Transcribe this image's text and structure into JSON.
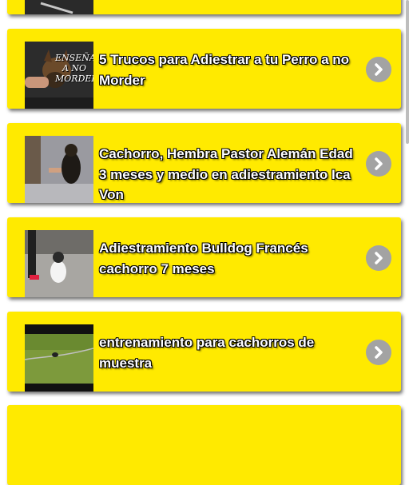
{
  "videos": [
    {
      "title": ""
    },
    {
      "title": "5 Trucos para Adiestrar a tu Perro a no Morder",
      "thumb_caption": "ENSEÑALE A NO MORDER"
    },
    {
      "title": "Cachorro, Hembra Pastor Alemán Edad 3 meses y medio en adiestramiento Ica Von"
    },
    {
      "title": "Adiestramiento Bulldog Francés cachorro 7 meses"
    },
    {
      "title": "entrenamiento para cachorros de muestra"
    },
    {
      "title": ""
    }
  ],
  "icons": {
    "next": "chevron-right-icon"
  },
  "colors": {
    "card": "#ffea00",
    "chevron_bg": "#a3a3a3"
  }
}
